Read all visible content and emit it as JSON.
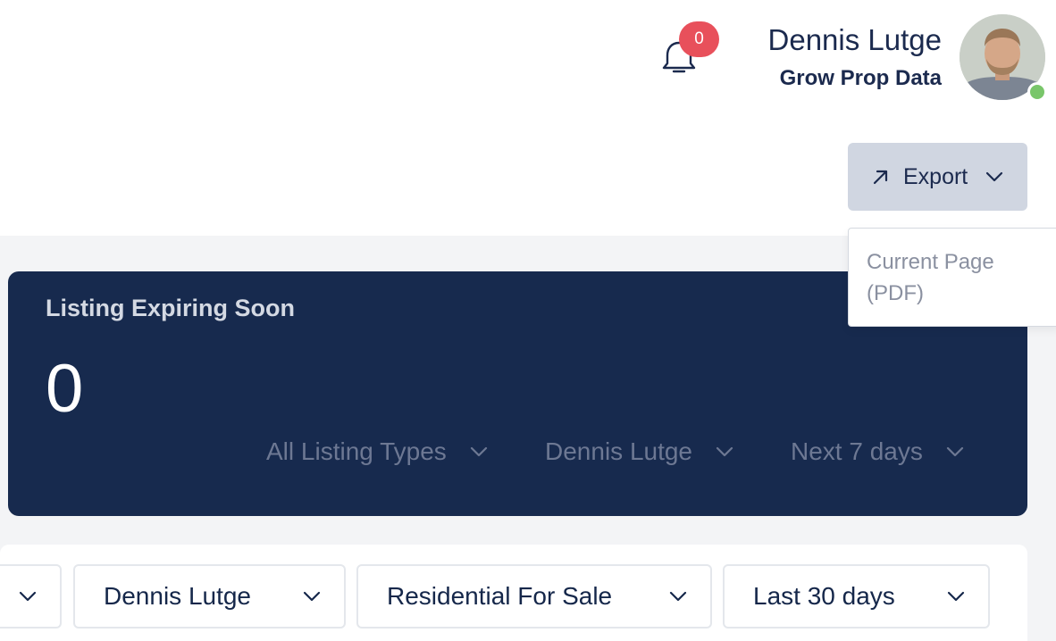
{
  "header": {
    "notifications_count": "0",
    "user_name": "Dennis Lutge",
    "user_org": "Grow Prop Data",
    "status_color": "#79c66a"
  },
  "toolbar": {
    "export_label": "Export",
    "export_menu": [
      "Current Page (PDF)"
    ]
  },
  "card": {
    "title": "Listing Expiring Soon",
    "value": "0",
    "filters": [
      {
        "label": "All Listing Types"
      },
      {
        "label": "Dennis Lutge"
      },
      {
        "label": "Next 7 days"
      }
    ]
  },
  "filter_bar": {
    "selects": [
      {
        "label": ""
      },
      {
        "label": "Dennis Lutge"
      },
      {
        "label": "Residential For Sale"
      },
      {
        "label": "Last 30 days"
      }
    ]
  },
  "colors": {
    "card_bg": "#172a4e",
    "badge": "#e8505b",
    "export_bg": "#d0d6e1"
  }
}
